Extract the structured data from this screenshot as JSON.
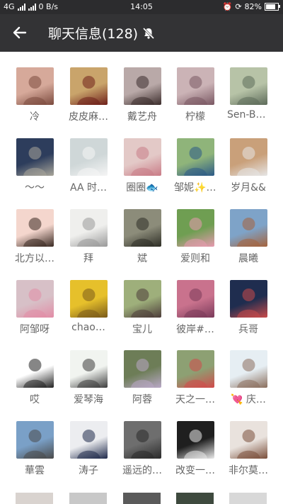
{
  "status": {
    "network": "4G",
    "speed": "0 B/s",
    "time": "14:05",
    "battery": "82%",
    "battery_level": 0.82
  },
  "header": {
    "title": "聊天信息(128)"
  },
  "members": [
    {
      "name": "冷",
      "bg": "#d6a99a",
      "fg": "#7b4a3e"
    },
    {
      "name": "皮皮麻…",
      "bg": "#c9a46b",
      "fg": "#6e1f1a"
    },
    {
      "name": "戴艺舟",
      "bg": "#b9a9a8",
      "fg": "#3b2c2b"
    },
    {
      "name": "柠檬",
      "bg": "#cbb3b6",
      "fg": "#7a5863"
    },
    {
      "name": "Sen-Br…",
      "bg": "#b7c3a7",
      "fg": "#5d6b5a"
    },
    {
      "name": "〜〜",
      "bg": "#2d3d5c",
      "fg": "#a9a69a"
    },
    {
      "name": "AA 时…",
      "bg": "#cfd7d8",
      "fg": "#f5f5f5"
    },
    {
      "name": "圈圈🐟",
      "bg": "#e3c9c7",
      "fg": "#c97b86"
    },
    {
      "name": "邹妮✨✨",
      "bg": "#8fb47a",
      "fg": "#2c5a87"
    },
    {
      "name": "岁月&&",
      "bg": "#c9a07a",
      "fg": "#e6e6e6"
    },
    {
      "name": "北方以…",
      "bg": "#f4d6cd",
      "fg": "#3a2a23"
    },
    {
      "name": "拜",
      "bg": "#efefed",
      "fg": "#999"
    },
    {
      "name": "斌",
      "bg": "#8c8c7a",
      "fg": "#2e2e26"
    },
    {
      "name": "爱则和",
      "bg": "#6f9e52",
      "fg": "#e79ab0"
    },
    {
      "name": "晨曦",
      "bg": "#7ea3c8",
      "fg": "#a5633c"
    },
    {
      "name": "阿邹呀",
      "bg": "#d7c0c7",
      "fg": "#e28ca6"
    },
    {
      "name": "chao…",
      "bg": "#e6c02b",
      "fg": "#7a5a1a"
    },
    {
      "name": "宝儿",
      "bg": "#9eaf7b",
      "fg": "#4d3d3a"
    },
    {
      "name": "彼岸#…",
      "bg": "#c9728d",
      "fg": "#7a3a5a"
    },
    {
      "name": "兵哥",
      "bg": "#1f2d4f",
      "fg": "#c94a4a"
    },
    {
      "name": "哎",
      "bg": "#ffffff",
      "fg": "#222"
    },
    {
      "name": "爱琴海",
      "bg": "#f1f4f0",
      "fg": "#3d3d3d"
    },
    {
      "name": "阿蓉",
      "bg": "#6d7d57",
      "fg": "#b9a8c7"
    },
    {
      "name": "天之一…",
      "bg": "#8da073",
      "fg": "#d24a4a"
    },
    {
      "name": "💘 庆…",
      "bg": "#e6eef3",
      "fg": "#8a6e5c"
    },
    {
      "name": "華雲",
      "bg": "#7aa0c7",
      "fg": "#4a4a4a"
    },
    {
      "name": "涛子",
      "bg": "#ecedf0",
      "fg": "#1f2a4a"
    },
    {
      "name": "遥远的…",
      "bg": "#6e6e6e",
      "fg": "#2a2a2a"
    },
    {
      "name": "改变一…",
      "bg": "#1f1f1f",
      "fg": "#eaeaea"
    },
    {
      "name": "非尔莫…",
      "bg": "#e9e2dd",
      "fg": "#7a4e3a"
    }
  ]
}
